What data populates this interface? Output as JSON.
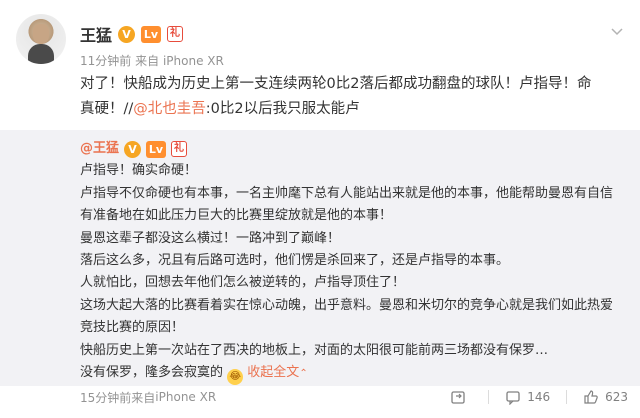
{
  "post": {
    "author": {
      "name": "王猛",
      "badges": {
        "verified": "V",
        "level": "Lv",
        "gift": "礼"
      }
    },
    "meta": {
      "time": "11分钟前",
      "source_prefix": "来自",
      "source": "iPhone XR"
    },
    "content": {
      "line1": "对了！快船成为历史上第一支连续两轮0比2落后都成功翻盘的球队！卢指导！命",
      "line2_prefix": "真硬！//",
      "mention": "@北也圭吾",
      "line2_suffix": ":0比2以后我只服太能卢"
    },
    "repost": {
      "author": "@王猛",
      "lines": [
        "卢指导！确实命硬！",
        "卢指导不仅命硬也有本事，一名主帅麾下总有人能站出来就是他的本事，他能帮助曼恩有自信",
        "有准备地在如此压力巨大的比赛里绽放就是他的本事！",
        "曼恩这辈子都没这么横过！一路冲到了巅峰！",
        "落后这么多，况且有后路可选时，他们愣是杀回来了，还是卢指导的本事。",
        "人就怕比，回想去年他们怎么被逆转的，卢指导顶住了！",
        "这场大起大落的比赛看着实在惊心动魄，出乎意料。曼恩和米切尔的竞争心就是我们如此热爱",
        "竞技比赛的原因！",
        "快船历史上第一次站在了西决的地板上，对面的太阳很可能前两三场都没有保罗…"
      ],
      "last_line_text": "没有保罗，隆多会寂寞的",
      "collapse_label": "收起全文",
      "meta": {
        "time": "15分钟前",
        "source_prefix": "来自",
        "source": "iPhone XR"
      },
      "actions": {
        "shares": "",
        "comments": "146",
        "likes": "623"
      }
    }
  }
}
